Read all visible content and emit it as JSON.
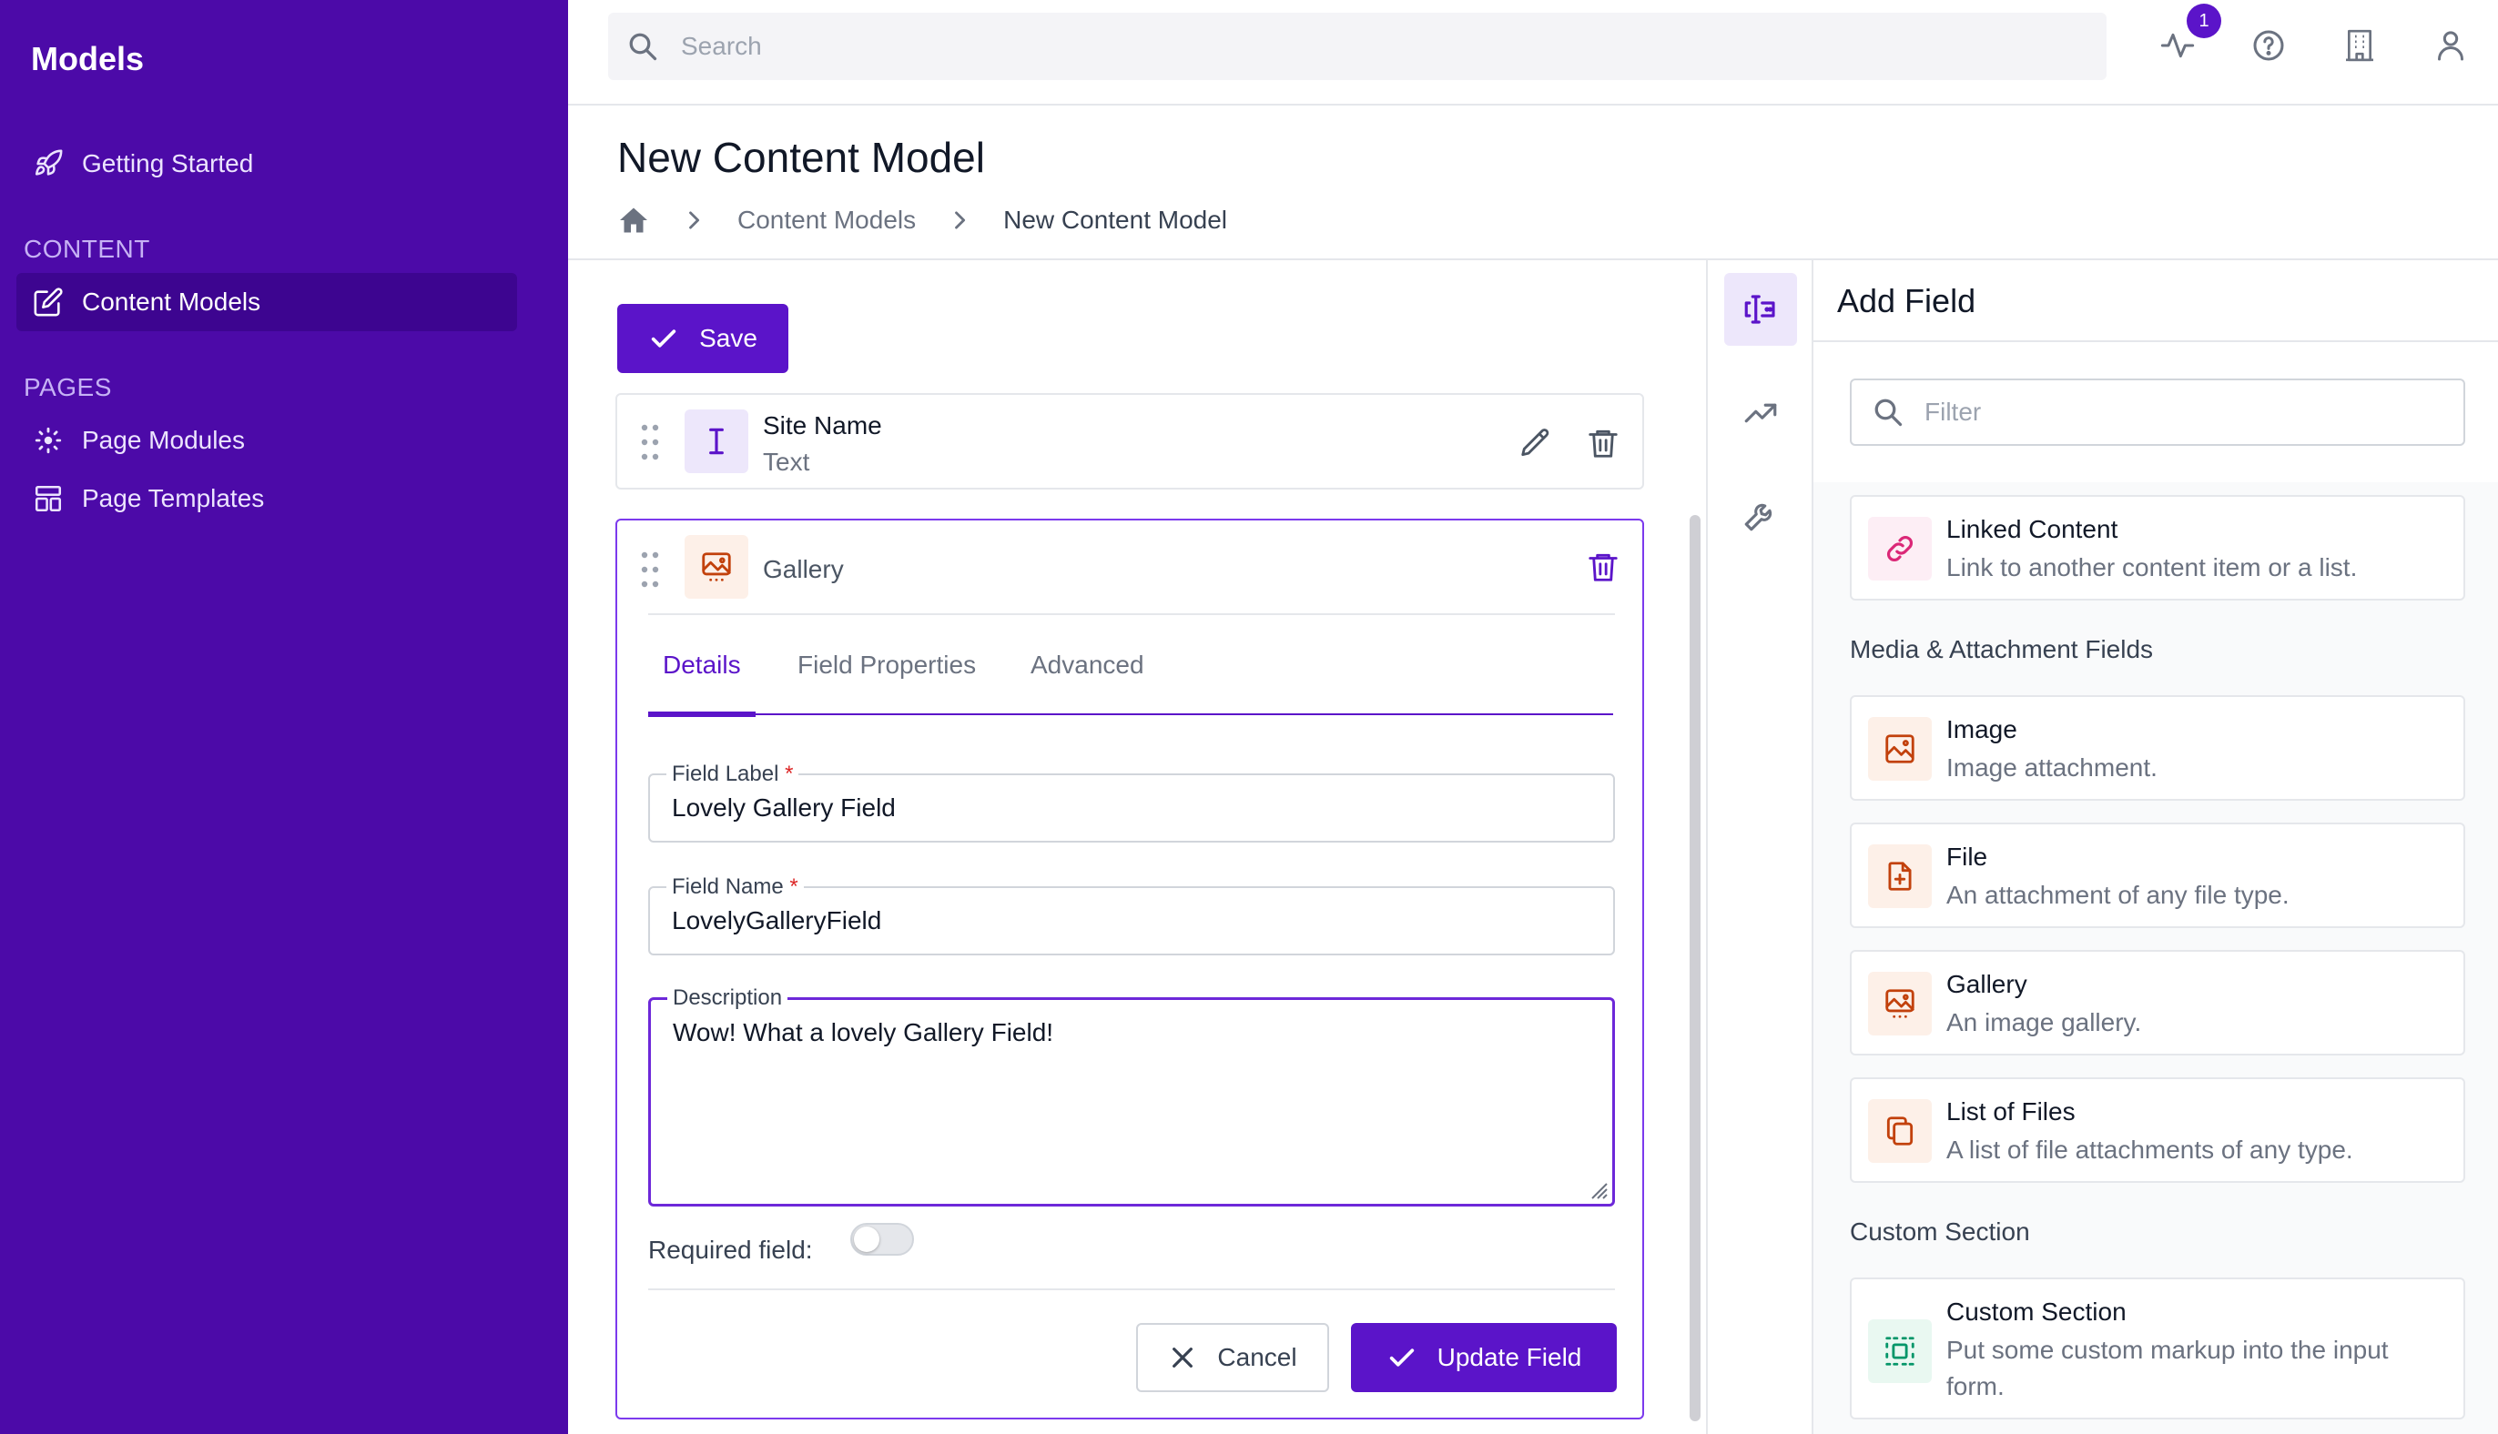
{
  "sidebar": {
    "title": "Models",
    "getting_started": "Getting Started",
    "section_content": "CONTENT",
    "content_models": "Content Models",
    "section_pages": "PAGES",
    "page_modules": "Page Modules",
    "page_templates": "Page Templates"
  },
  "topbar": {
    "search_placeholder": "Search",
    "notification_count": "1"
  },
  "header": {
    "title": "New Content Model",
    "breadcrumb": [
      "Content Models",
      "New Content Model"
    ]
  },
  "toolbar": {
    "save_label": "Save"
  },
  "fields": [
    {
      "title": "Site Name",
      "type": "Text"
    },
    {
      "title": "Gallery"
    }
  ],
  "editor": {
    "tabs": [
      "Details",
      "Field Properties",
      "Advanced"
    ],
    "active_tab": "Details",
    "label_field": {
      "label": "Field Label",
      "value": "Lovely Gallery Field"
    },
    "name_field": {
      "label": "Field Name",
      "value": "LovelyGalleryField"
    },
    "description_field": {
      "label": "Description",
      "value": "Wow! What a lovely Gallery Field!"
    },
    "required_label": "Required field:",
    "required_on": false,
    "cancel_label": "Cancel",
    "update_label": "Update Field"
  },
  "add_field": {
    "title": "Add Field",
    "filter_placeholder": "Filter",
    "linked": {
      "title": "Linked Content",
      "desc": "Link to another content item or a list."
    },
    "group_media": "Media & Attachment Fields",
    "image": {
      "title": "Image",
      "desc": "Image attachment."
    },
    "file": {
      "title": "File",
      "desc": "An attachment of any file type."
    },
    "gallery": {
      "title": "Gallery",
      "desc": "An image gallery."
    },
    "list_of_files": {
      "title": "List of Files",
      "desc": "A list of file attachments of any type."
    },
    "group_custom": "Custom Section",
    "custom_section": {
      "title": "Custom Section",
      "desc": "Put some custom markup into the input form."
    }
  },
  "colors": {
    "sidebar_bg": "#4c0aa8",
    "accent": "#5b14c9",
    "media_icon": "#c2410c",
    "link_icon": "#db2777",
    "custom_icon": "#059669"
  }
}
